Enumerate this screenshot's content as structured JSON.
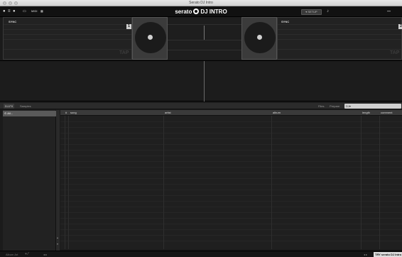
{
  "window": {
    "title": "Serato DJ Intro"
  },
  "topbar": {
    "logo_text": "serato",
    "product": "DJ INTRO",
    "setup_label": "SETUP",
    "icons": [
      "rec-icon",
      "midi-icon",
      "mixer-icon",
      "minimize-icon"
    ]
  },
  "decks": {
    "left": {
      "sync_label": "SYNC",
      "number": "1",
      "tap_label": "TAP"
    },
    "right": {
      "sync_label": "SYNC",
      "number": "2",
      "tap_label": "TAP"
    }
  },
  "library": {
    "tabs": [
      "DJ-FX",
      "Samples"
    ],
    "right_tabs": [
      "Files",
      "Prepare"
    ],
    "search_placeholder": "DJ▾"
  },
  "sidebar": {
    "crates": [
      {
        "label": "All..."
      }
    ]
  },
  "table": {
    "columns": [
      "#",
      "song",
      "artist",
      "album",
      "length",
      "comment"
    ]
  },
  "bottom": {
    "album_art_label": "Album Art",
    "try_label": "TRY serato DJ Intro"
  },
  "colors": {
    "accent": "#d0d0d0",
    "background": "#1b1b1b"
  }
}
